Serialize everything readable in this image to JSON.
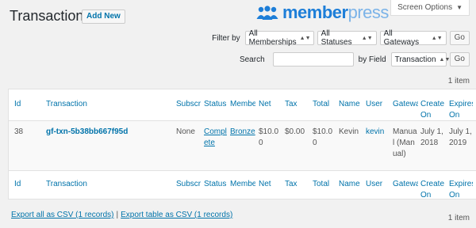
{
  "header": {
    "title": "Transactions",
    "add_new_label": "Add New",
    "screen_options_label": "Screen Options",
    "logo_brand_primary": "member",
    "logo_brand_secondary": "press",
    "logo_colors": {
      "primary": "#1d7ed8",
      "secondary": "#7bb3e8"
    }
  },
  "filters": {
    "filter_by_label": "Filter by",
    "memberships_value": "All Memberships",
    "statuses_value": "All Statuses",
    "gateways_value": "All Gateways",
    "go_label": "Go"
  },
  "search": {
    "label": "Search",
    "value": "",
    "by_field_label": "by Field",
    "field_value": "Transaction",
    "go_label": "Go"
  },
  "items_count_top": "1 item",
  "items_count_bottom": "1 item",
  "table": {
    "columns": [
      "Id",
      "Transaction",
      "Subscr",
      "Status",
      "Membe",
      "Net",
      "Tax",
      "Total",
      "Name",
      "User",
      "Gatewa",
      "Created On",
      "Expires On"
    ],
    "rows": [
      {
        "id": "38",
        "transaction": "gf-txn-5b38bb667f95d",
        "subscription": "None",
        "status": "Complete",
        "membership": "Bronze",
        "net": "$10.00",
        "tax": "$0.00",
        "total": "$10.00",
        "name": "Kevin",
        "user": "kevin",
        "gateway": "Manual (Manual)",
        "created_on": "July 1, 2018",
        "expires_on": "July 1, 2019"
      }
    ]
  },
  "export": {
    "export_all_label": "Export all as CSV (1 records)",
    "separator": "|",
    "export_table_label": "Export table as CSV (1 records)"
  }
}
